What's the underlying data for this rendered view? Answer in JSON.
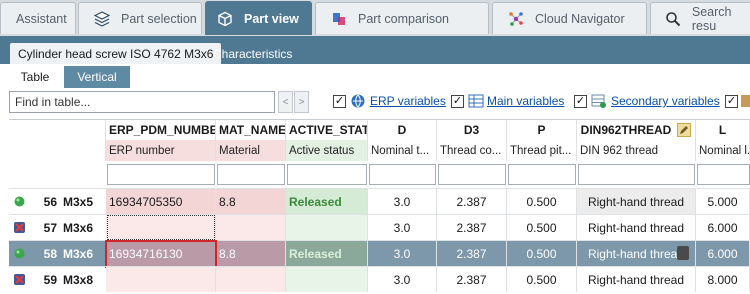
{
  "top_tabs": [
    {
      "label": "Assistant",
      "icon": "none"
    },
    {
      "label": "Part selection",
      "icon": "stack-icon"
    },
    {
      "label": "Part view",
      "icon": "cube-icon"
    },
    {
      "label": "Part comparison",
      "icon": "compare-icon"
    },
    {
      "label": "Cloud Navigator",
      "icon": "network-icon"
    },
    {
      "label": "Search resu",
      "icon": "search-icon"
    }
  ],
  "sub_tabs": [
    "Cylinder head screw ISO 4762 M3x6",
    "Characteristics"
  ],
  "view_tabs": [
    "Table",
    "Vertical"
  ],
  "find": {
    "placeholder": "Find in table..."
  },
  "nav": {
    "prev": "<",
    "next": ">"
  },
  "filters": [
    {
      "label": "ERP variables",
      "checked": true,
      "icon": "erp-icon"
    },
    {
      "label": "Main variables",
      "checked": true,
      "icon": "main-vars-icon"
    },
    {
      "label": "Secondary variables",
      "checked": true,
      "icon": "secondary-vars-icon"
    }
  ],
  "columns": [
    {
      "key": "ERP_PDM_NUMBER",
      "desc": "ERP number"
    },
    {
      "key": "MAT_NAME",
      "desc": "Material"
    },
    {
      "key": "ACTIVE_STATE",
      "desc": "Active status"
    },
    {
      "key": "D",
      "desc": "Nominal t..."
    },
    {
      "key": "D3",
      "desc": "Thread co..."
    },
    {
      "key": "P",
      "desc": "Thread pit..."
    },
    {
      "key": "DIN962THREAD",
      "desc": "DIN 962 thread"
    },
    {
      "key": "L",
      "desc": "Nominal l..."
    }
  ],
  "rows": [
    {
      "num": "56",
      "label": "M3x5",
      "status": "green",
      "erp": "16934705350",
      "mat": "8.8",
      "active": "Released",
      "d": "3.0",
      "d3": "2.387",
      "p": "0.500",
      "din": "Right-hand thread",
      "l": "5.000"
    },
    {
      "num": "57",
      "label": "M3x6",
      "status": "red-x",
      "erp": "",
      "mat": "",
      "active": "",
      "d": "3.0",
      "d3": "2.387",
      "p": "0.500",
      "din": "Right-hand thread",
      "l": "6.000"
    },
    {
      "num": "58",
      "label": "M3x6",
      "status": "green",
      "erp": "16934716130",
      "mat": "8.8",
      "active": "Released",
      "d": "3.0",
      "d3": "2.387",
      "p": "0.500",
      "din": "Right-hand thread",
      "l": "6.000"
    },
    {
      "num": "59",
      "label": "M3x8",
      "status": "red-x",
      "erp": "",
      "mat": "",
      "active": "",
      "d": "3.0",
      "d3": "2.387",
      "p": "0.500",
      "din": "Right-hand thread",
      "l": "8.000"
    }
  ],
  "selected_row": "58",
  "colors": {
    "accent": "#4f7893",
    "selected_row": "#7d98ab",
    "highlight_border": "#d0262a"
  }
}
